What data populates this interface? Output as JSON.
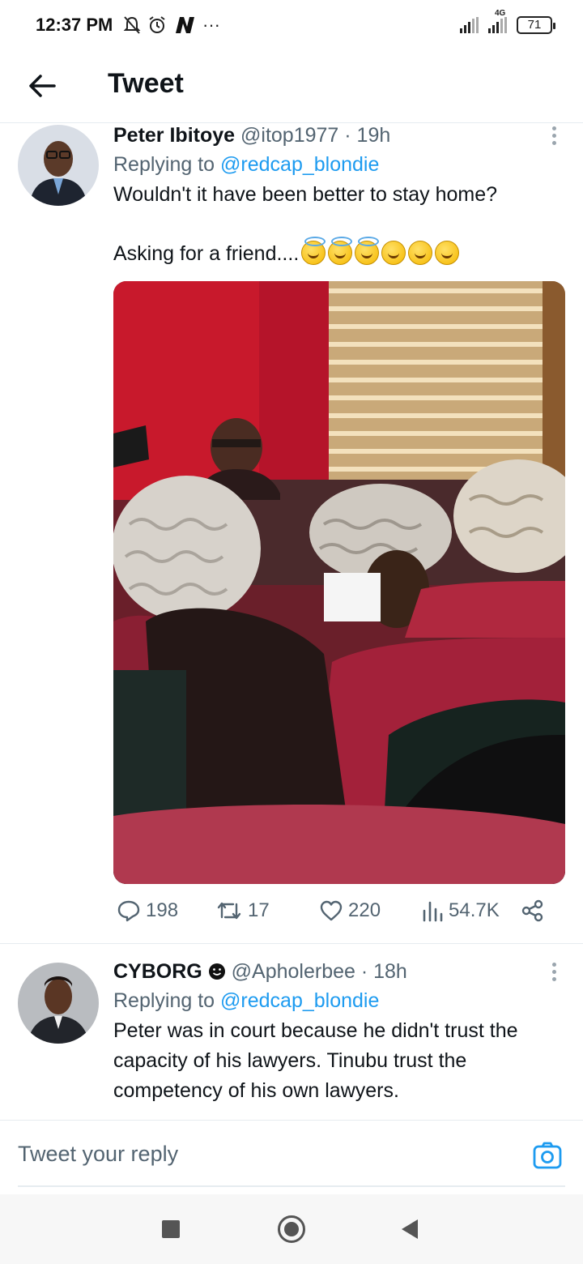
{
  "status_bar": {
    "time": "12:37 PM",
    "icons_left": [
      "mute-icon",
      "alarm-icon",
      "n-app-icon",
      "more-dots-icon"
    ],
    "network": "4G",
    "battery": "71"
  },
  "header": {
    "title": "Tweet"
  },
  "tweets": [
    {
      "name": "Peter  Ibitoye",
      "handle": "@itop1977 · 19h",
      "replying_label": "Replying to ",
      "replying_to": "@redcap_blondie",
      "text_line1": "Wouldn't it have been better to stay home?",
      "text_line2": "Asking for a friend....",
      "emojis": [
        "halo-smile",
        "halo-smile",
        "halo-smile",
        "laughing",
        "laughing",
        "laughing"
      ],
      "has_photo": true,
      "stats": {
        "replies": "198",
        "retweets": "17",
        "likes": "220",
        "views": "54.7K"
      }
    },
    {
      "name": "CYBORG",
      "handle": "@Apholerbee · 18h",
      "replying_label": "Replying to ",
      "replying_to": "@redcap_blondie",
      "text": "Peter was in court because he didn't trust the capacity of his lawyers. Tinubu trust the competency of his own lawyers."
    }
  ],
  "reply_box": {
    "placeholder": "Tweet your reply"
  },
  "colors": {
    "accent": "#1d9bf0",
    "text_secondary": "#536471"
  }
}
